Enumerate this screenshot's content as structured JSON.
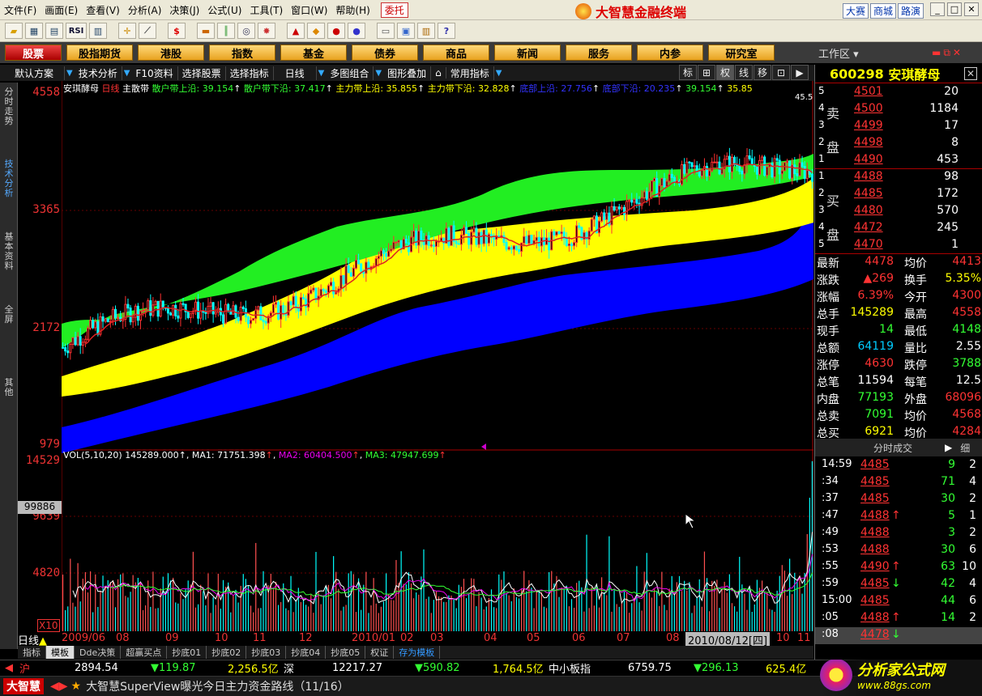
{
  "menu": [
    "文件(F)",
    "画面(E)",
    "查看(V)",
    "分析(A)",
    "决策(J)",
    "公式(U)",
    "工具(T)",
    "窗口(W)",
    "帮助(H)"
  ],
  "menu_weituo": "委托",
  "app_title": "大智慧金融终端",
  "top_links": [
    "大赛",
    "商城",
    "路演"
  ],
  "window_buttons": [
    "_",
    "□",
    "✕"
  ],
  "toolbar_rsi": "RSI",
  "nav_tabs": [
    "股票",
    "股指期货",
    "港股",
    "指数",
    "基金",
    "债券",
    "商品",
    "新闻",
    "服务",
    "内参",
    "研究室"
  ],
  "workzone": "工作区",
  "left_tabs": [
    "分时走势",
    "技术分析",
    "基本资料",
    "全屏",
    "其他"
  ],
  "chart_toolbar": [
    "默认方案",
    "技术分析",
    "F10资料",
    "选择股票",
    "选择指标",
    "日线",
    "多图组合",
    "图形叠加",
    "常用指标"
  ],
  "chart_right_buttons": [
    "标",
    "⊞",
    "权",
    "线",
    "移",
    "⊡",
    "▶"
  ],
  "price_legend": {
    "name": "安琪酵母",
    "period": "日线",
    "indicator": "主散带",
    "items": [
      {
        "label": "散户带上沿: 39.154",
        "color": "#3f3"
      },
      {
        "label": "散户带下沿: 37.417",
        "color": "#3f3"
      },
      {
        "label": "主力带上沿: 35.855",
        "color": "#ff0"
      },
      {
        "label": "主力带下沿: 32.828",
        "color": "#ff0"
      },
      {
        "label": "底部上沿: 27.756",
        "color": "#33f"
      },
      {
        "label": "底部下沿: 20.235",
        "color": "#33f"
      },
      {
        "label": "39.154",
        "color": "#3f3"
      },
      {
        "label": "35.85",
        "color": "#ff0"
      }
    ],
    "last_price_label": "45.50"
  },
  "vol_legend": {
    "label": "VOL(5,10,20)",
    "value": "145289.000",
    "ma1": "MA1: 71751.398",
    "ma2": "MA2: 60404.500",
    "ma3": "MA3: 47947.699"
  },
  "price_axis": [
    "4558",
    "3365",
    "2172",
    "979"
  ],
  "vol_axis": [
    "14529",
    "9639",
    "4820"
  ],
  "vol_badge": "99886",
  "vol_unit": "X10",
  "x_axis_labels": [
    "2009/06",
    "08",
    "09",
    "10",
    "11",
    "12",
    "2010/01",
    "02",
    "03",
    "04",
    "05",
    "06",
    "07",
    "08",
    "2010/08/12[四]",
    "10",
    "11"
  ],
  "day_line": "日线",
  "bottom_tabs": [
    "指标",
    "模板",
    "Dde决策",
    "超赢买点",
    "抄底01",
    "抄底02",
    "抄底03",
    "抄底04",
    "抄底05",
    "权证",
    "存为模板"
  ],
  "quote": {
    "code": "600298",
    "name": "安琪酵母",
    "sell_label": "卖盘",
    "buy_label": "买盘",
    "sell": [
      {
        "lvl": "5",
        "price": "4501",
        "vol": "20"
      },
      {
        "lvl": "4",
        "price": "4500",
        "vol": "1184"
      },
      {
        "lvl": "3",
        "price": "4499",
        "vol": "17"
      },
      {
        "lvl": "2",
        "price": "4498",
        "vol": "8"
      },
      {
        "lvl": "1",
        "price": "4490",
        "vol": "453"
      }
    ],
    "buy": [
      {
        "lvl": "1",
        "price": "4488",
        "vol": "98"
      },
      {
        "lvl": "2",
        "price": "4485",
        "vol": "172"
      },
      {
        "lvl": "3",
        "price": "4480",
        "vol": "570"
      },
      {
        "lvl": "4",
        "price": "4472",
        "vol": "245"
      },
      {
        "lvl": "5",
        "price": "4470",
        "vol": "1"
      }
    ],
    "stats": [
      {
        "k1": "最新",
        "v1": "4478",
        "c1": "r",
        "k2": "均价",
        "v2": "4413",
        "c2": "r"
      },
      {
        "k1": "涨跌",
        "v1": "▲269",
        "c1": "r",
        "k2": "换手",
        "v2": "5.35%",
        "c2": "y"
      },
      {
        "k1": "涨幅",
        "v1": "6.39%",
        "c1": "r",
        "k2": "今开",
        "v2": "4300",
        "c2": "r"
      },
      {
        "k1": "总手",
        "v1": "145289",
        "c1": "y",
        "k2": "最高",
        "v2": "4558",
        "c2": "r"
      },
      {
        "k1": "现手",
        "v1": "14",
        "c1": "g",
        "k2": "最低",
        "v2": "4148",
        "c2": "g"
      },
      {
        "k1": "总额",
        "v1": "64119",
        "c1": "c",
        "k2": "量比",
        "v2": "2.55",
        "c2": "w"
      },
      {
        "k1": "涨停",
        "v1": "4630",
        "c1": "r",
        "k2": "跌停",
        "v2": "3788",
        "c2": "g"
      },
      {
        "k1": "总笔",
        "v1": "11594",
        "c1": "w",
        "k2": "每笔",
        "v2": "12.5",
        "c2": "w"
      },
      {
        "k1": "内盘",
        "v1": "77193",
        "c1": "g",
        "k2": "外盘",
        "v2": "68096",
        "c2": "r"
      },
      {
        "k1": "总卖",
        "v1": "7091",
        "c1": "g",
        "k2": "均价",
        "v2": "4568",
        "c2": "r"
      },
      {
        "k1": "总买",
        "v1": "6921",
        "c1": "y",
        "k2": "均价",
        "v2": "4284",
        "c2": "r"
      }
    ],
    "ticks_header": "分时成交",
    "ticks_detail": "细",
    "ticks": [
      {
        "t": "14:59",
        "p": "4485",
        "a": "",
        "v": "9",
        "n": "2"
      },
      {
        "t": ":34",
        "p": "4485",
        "a": "",
        "v": "71",
        "n": "4"
      },
      {
        "t": ":37",
        "p": "4485",
        "a": "",
        "v": "30",
        "n": "2"
      },
      {
        "t": ":47",
        "p": "4488",
        "a": "↑",
        "v": "5",
        "n": "1"
      },
      {
        "t": ":49",
        "p": "4488",
        "a": "",
        "v": "3",
        "n": "2"
      },
      {
        "t": ":53",
        "p": "4488",
        "a": "",
        "v": "30",
        "n": "6"
      },
      {
        "t": ":55",
        "p": "4490",
        "a": "↑",
        "v": "63",
        "n": "10"
      },
      {
        "t": ":59",
        "p": "4485",
        "a": "↓",
        "v": "42",
        "n": "4"
      },
      {
        "t": "15:00",
        "p": "4485",
        "a": "",
        "v": "44",
        "n": "6"
      },
      {
        "t": ":05",
        "p": "4488",
        "a": "↑",
        "v": "14",
        "n": "2"
      },
      {
        "t": ":08",
        "p": "4478",
        "a": "↓",
        "v": "",
        "n": ""
      }
    ]
  },
  "ticker": {
    "sh_label": "沪",
    "sh_index": "2894.54",
    "sh_change": "▼119.87",
    "sh_amount": "2,256.5亿",
    "sz_label": "深",
    "sz_index": "12217.27",
    "sz_change": "▼590.82",
    "sz_amount": "1,764.5亿",
    "zx_label": "中小板指",
    "zx_index": "6759.75",
    "zx_change": "▼296.13",
    "zx_amount": "625.4亿"
  },
  "news": {
    "brand": "大智慧",
    "text": "大智慧SuperView曝光今日主力资金路线（11/16）"
  },
  "watermark": {
    "title": "分析家公式网",
    "url": "www.88gs.com"
  },
  "chart_data": {
    "type": "candlestick",
    "title": "安琪酵母 日线",
    "ylim": [
      979,
      4558
    ],
    "vol_ylim": [
      0,
      14529
    ],
    "start_label": "2009/06",
    "end_label": "2010/11",
    "last_close": 4478,
    "last_volume": 145289
  }
}
